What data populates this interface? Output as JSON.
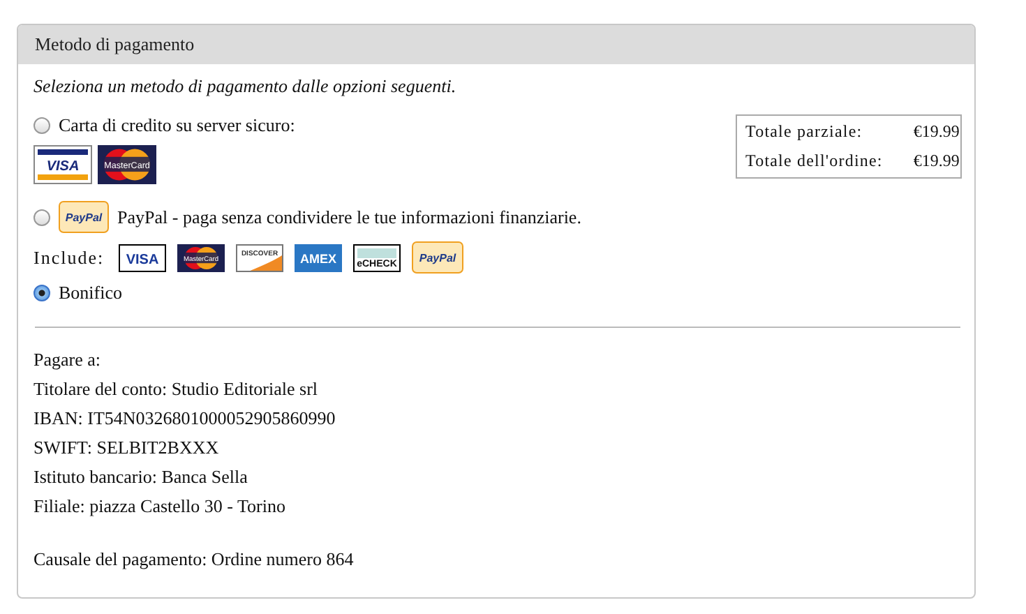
{
  "panel": {
    "title": "Metodo di pagamento",
    "intro": "Seleziona un metodo di pagamento dalle opzioni seguenti."
  },
  "methods": [
    {
      "kind": "card",
      "label": "Carta di credito su server sicuro:",
      "selected": false,
      "logos": [
        {
          "kind": "visa",
          "text": "VISA"
        },
        {
          "kind": "mastercard",
          "text": "MasterCard"
        }
      ]
    },
    {
      "kind": "paypal",
      "label": "PayPal - paga senza condividere le tue informazioni finanziarie.",
      "selected": false,
      "badge": {
        "kind": "paypal",
        "text": "PayPal"
      },
      "include_label": "Include:",
      "logos": [
        {
          "kind": "visa_plain",
          "text": "VISA"
        },
        {
          "kind": "mastercard",
          "text": "MasterCard"
        },
        {
          "kind": "discover",
          "text": "DISCOVER"
        },
        {
          "kind": "amex",
          "text": "AMEX"
        },
        {
          "kind": "echeck",
          "text": "eCHECK"
        },
        {
          "kind": "paypal",
          "text": "PayPal"
        }
      ]
    },
    {
      "kind": "plain",
      "label": "Bonifico",
      "selected": true
    }
  ],
  "totals": [
    {
      "label": "Totale parziale:",
      "value": "€19.99"
    },
    {
      "label": "Totale dell'ordine:",
      "value": "€19.99"
    }
  ],
  "bank_details": [
    "Pagare a:",
    "Titolare del conto: Studio Editoriale srl",
    "IBAN: IT54N0326801000052905860990",
    "SWIFT: SELBIT2BXXX",
    "Istituto bancario: Banca Sella",
    "Filiale: piazza Castello 30 - Torino"
  ],
  "payment_reason": "Causale del pagamento: Ordine numero 864"
}
